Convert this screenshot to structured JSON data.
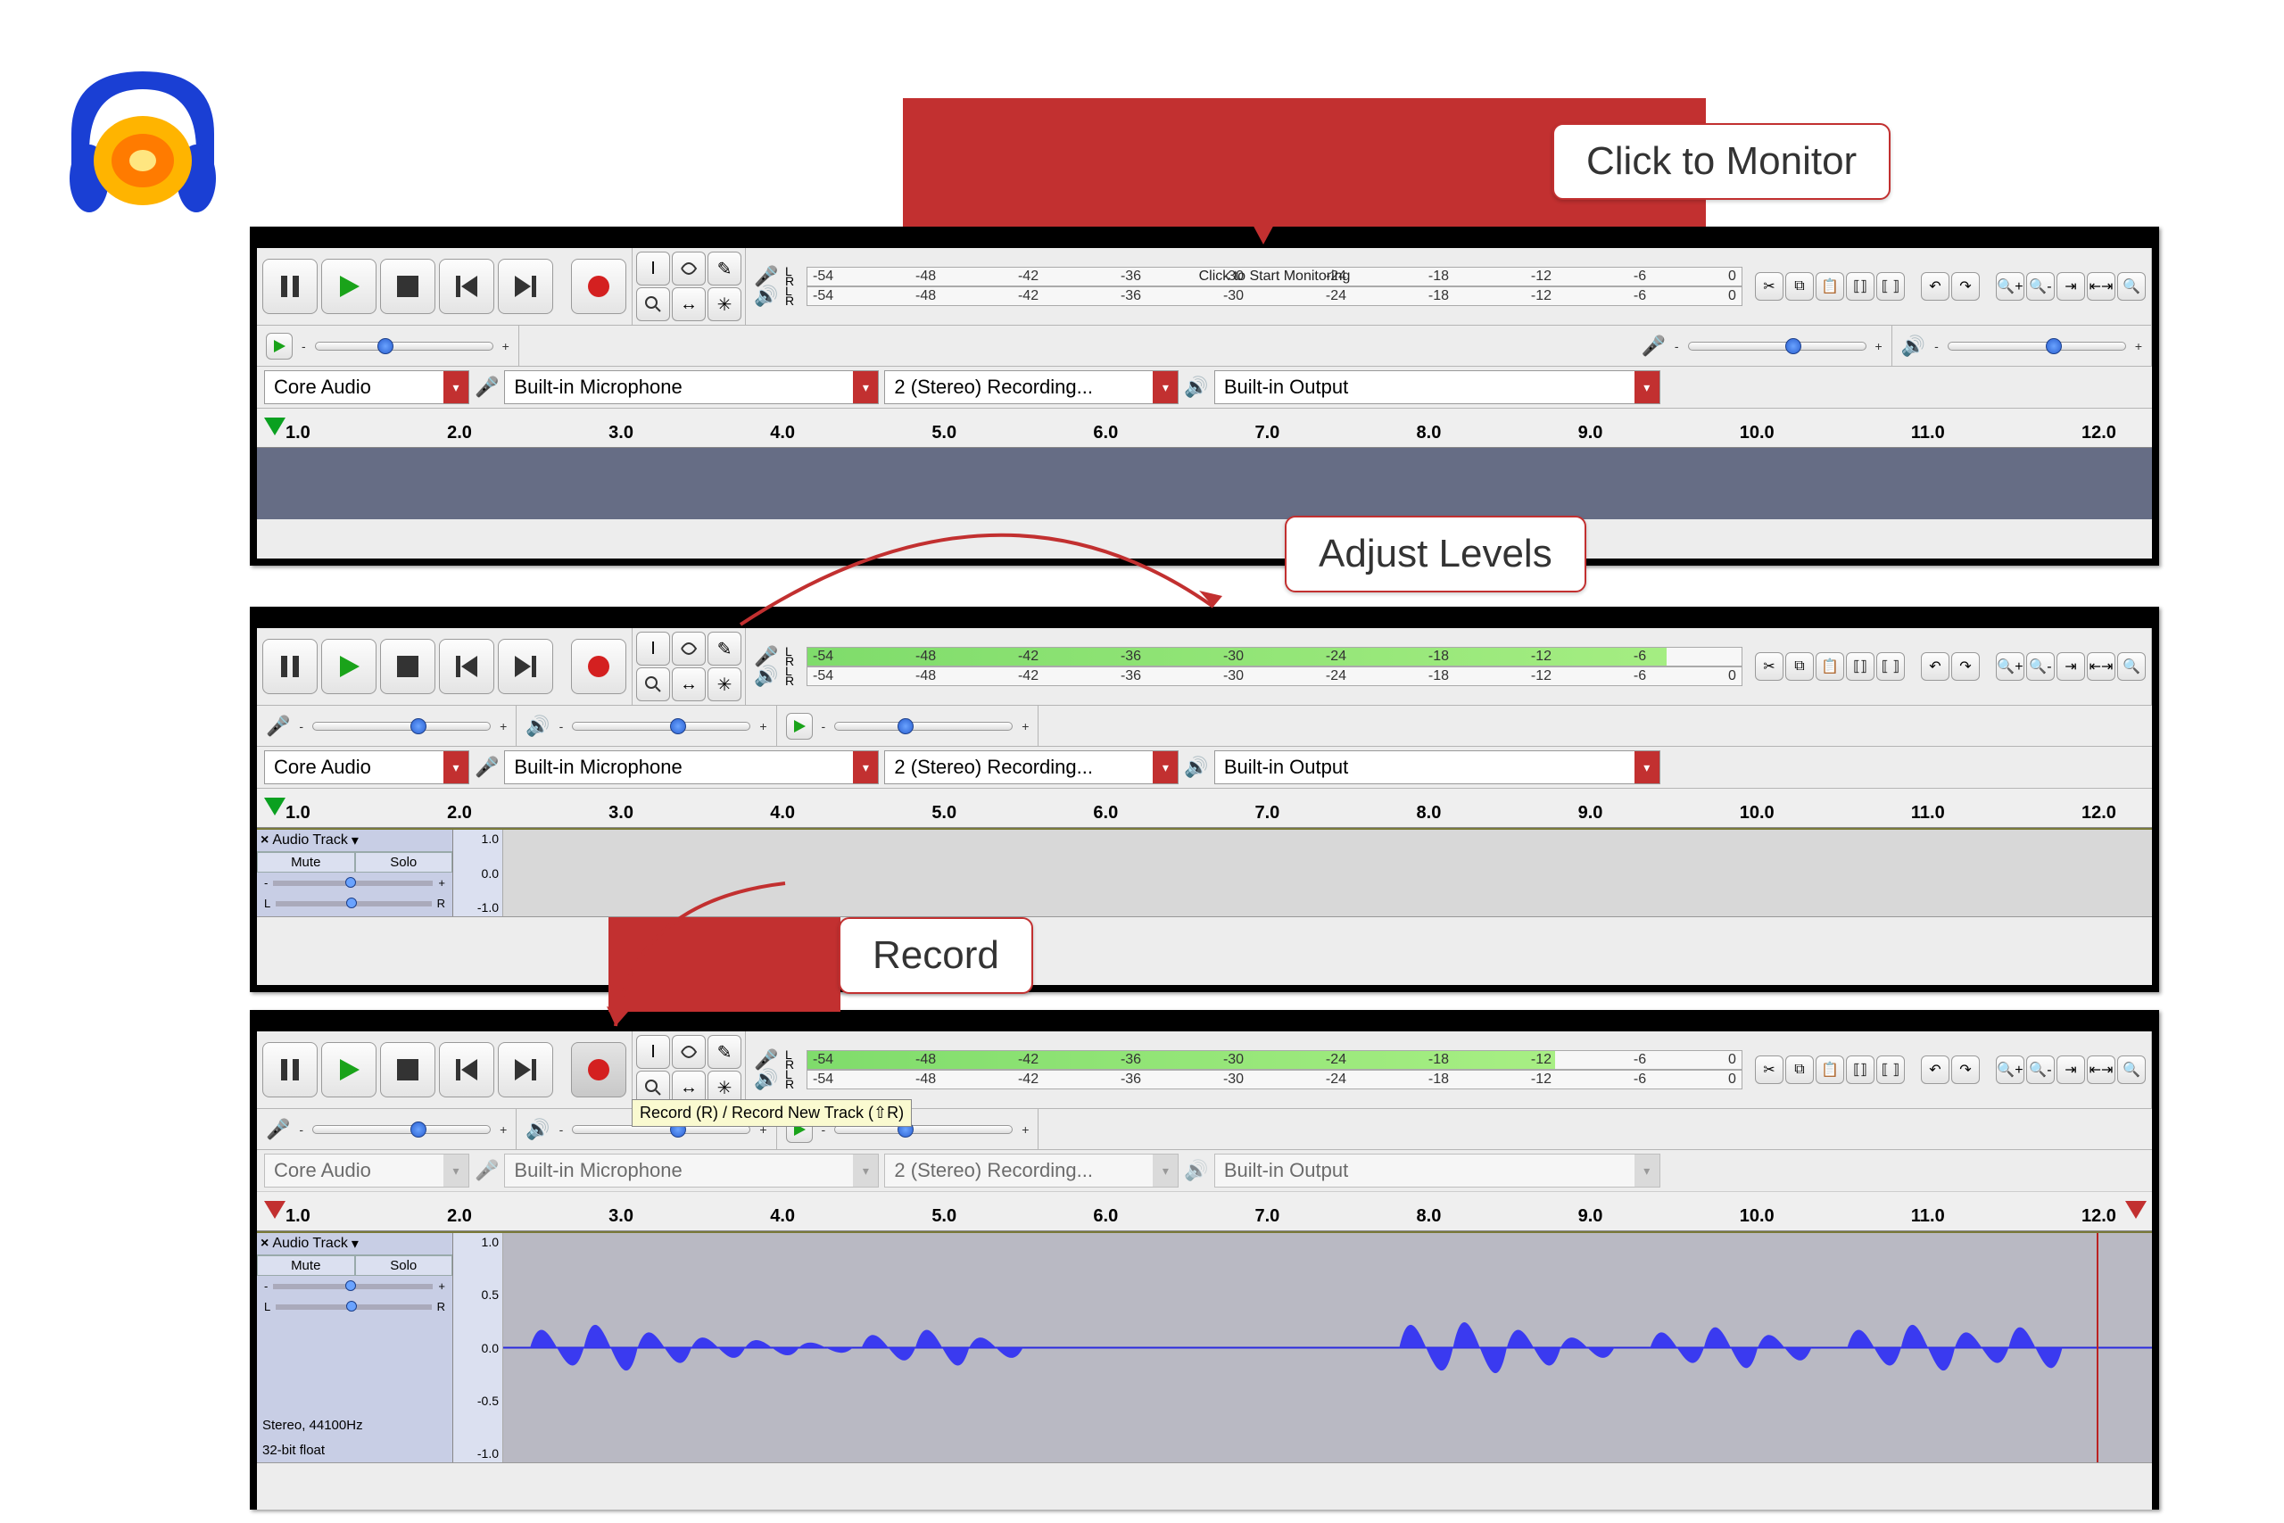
{
  "callouts": {
    "monitor": "Click to Monitor",
    "levels": "Adjust Levels",
    "record": "Record"
  },
  "tooltip_record": "Record (R) / Record New Track (⇧R)",
  "meter": {
    "start_monitoring": "Click to Start Monitoring",
    "ticks": [
      "-54",
      "-48",
      "-42",
      "-36",
      "-30",
      "-24",
      "-18",
      "-12",
      "-6",
      "0"
    ],
    "L": "L",
    "R": "R"
  },
  "devices": {
    "host": "Core Audio",
    "input": "Built-in Microphone",
    "channels": "2 (Stereo) Recording...",
    "output": "Built-in Output"
  },
  "timeline": [
    "1.0",
    "2.0",
    "3.0",
    "4.0",
    "5.0",
    "6.0",
    "7.0",
    "8.0",
    "9.0",
    "10.0",
    "11.0",
    "12.0"
  ],
  "track": {
    "name": "Audio Track",
    "mute": "Mute",
    "solo": "Solo",
    "fmt1": "Stereo, 44100Hz",
    "fmt2": "32-bit float",
    "amp": [
      "1.0",
      "0.5",
      "0.0",
      "-0.5",
      "-1.0"
    ],
    "amp_short": [
      "1.0",
      "0.0",
      "-1.0"
    ],
    "gain_minus": "-",
    "gain_plus": "+",
    "pan_l": "L",
    "pan_r": "R"
  },
  "playspeed": {
    "minus": "-",
    "plus": "+"
  }
}
